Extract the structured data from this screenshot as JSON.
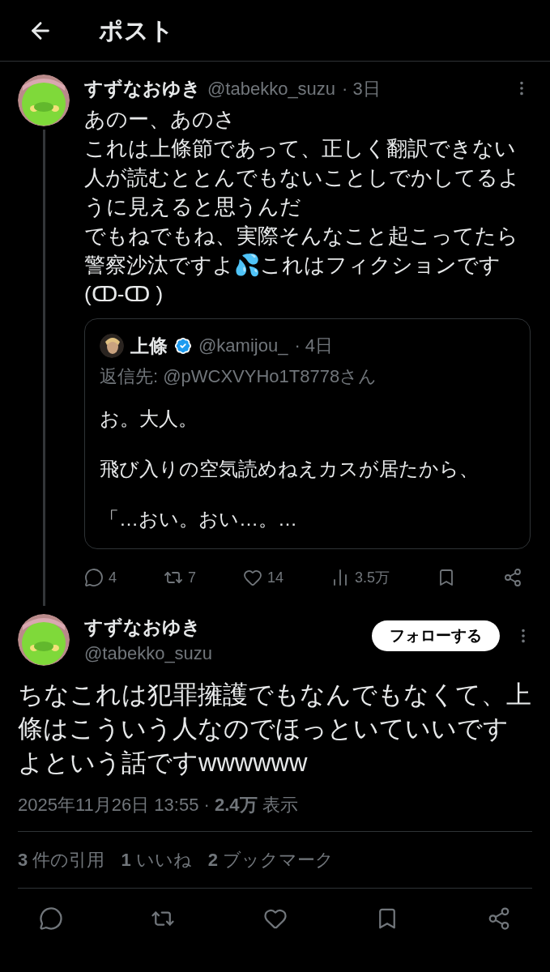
{
  "header": {
    "title": "ポスト"
  },
  "reply": {
    "name": "すずなおゆき",
    "handle": "@tabekko_suzu",
    "time": "· 3日",
    "paragraphs": [
      "あのー、あのさ",
      "これは上條節であって、正しく翻訳できない人が読むととんでもないことしでかしてるように見えると思うんだ",
      "でもねでもね、実際そんなこと起こってたら警察沙汰ですよ💦これはフィクションです",
      "(ↀ-ↀ )"
    ],
    "quote": {
      "name": "上條",
      "verified": true,
      "handle": "@kamijou_",
      "time": "· 4日",
      "reply_to": "返信先: @pWCXVYHo1T8778さん",
      "paragraphs": [
        "お。大人。",
        "飛び入りの空気読めねえカスが居たから、",
        "「…おい。おい…。…"
      ]
    },
    "actions": [
      {
        "kind": "reply",
        "count": "4"
      },
      {
        "kind": "repost",
        "count": "7"
      },
      {
        "kind": "like",
        "count": "14"
      },
      {
        "kind": "views",
        "count": "3.5万"
      },
      {
        "kind": "bookmark"
      },
      {
        "kind": "share"
      }
    ]
  },
  "main": {
    "name": "すずなおゆき",
    "handle": "@tabekko_suzu",
    "follow_button": "フォローする",
    "text": "ちなこれは犯罪擁護でもなんでもなくて、上條はこういう人なのでほっといていいですよという話ですwwwwww",
    "meta": "2025年11月26日 13:55 · **2.4万** 表示",
    "stats": [
      "**3** 件の引用",
      "**1** いいね",
      "**2** ブックマーク"
    ],
    "actions": [
      {
        "kind": "reply"
      },
      {
        "kind": "repost"
      },
      {
        "kind": "like"
      },
      {
        "kind": "bookmark"
      },
      {
        "kind": "share"
      }
    ]
  }
}
